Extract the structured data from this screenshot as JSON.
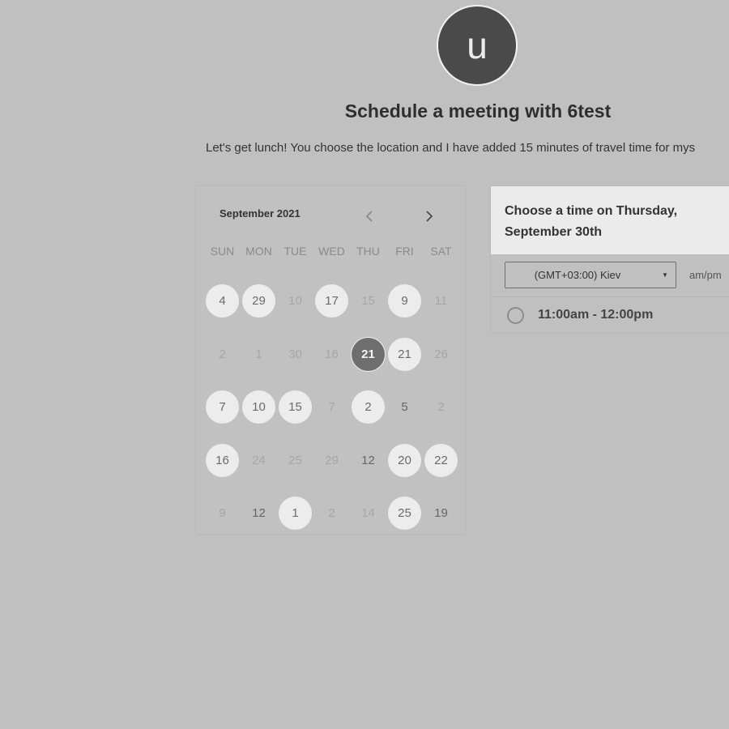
{
  "host": {
    "avatar_initial": "u",
    "title": "Schedule a meeting with 6test",
    "description": "Let's get lunch! You choose the location and I have added 15 minutes of travel time for mys"
  },
  "calendar": {
    "month_label": "September 2021",
    "prev_icon": "chevron-left-icon",
    "next_icon": "chevron-right-icon",
    "weekdays": [
      "SUN",
      "MON",
      "TUE",
      "WED",
      "THU",
      "FRI",
      "SAT"
    ],
    "weeks": [
      [
        {
          "label": "4",
          "state": "available"
        },
        {
          "label": "29",
          "state": "available"
        },
        {
          "label": "10",
          "state": "muted"
        },
        {
          "label": "17",
          "state": "available"
        },
        {
          "label": "15",
          "state": "muted"
        },
        {
          "label": "9",
          "state": "available"
        },
        {
          "label": "11",
          "state": "muted"
        }
      ],
      [
        {
          "label": "2",
          "state": "muted"
        },
        {
          "label": "1",
          "state": "muted"
        },
        {
          "label": "30",
          "state": "muted"
        },
        {
          "label": "16",
          "state": "muted"
        },
        {
          "label": "21",
          "state": "selected"
        },
        {
          "label": "21",
          "state": "available"
        },
        {
          "label": "26",
          "state": "muted"
        }
      ],
      [
        {
          "label": "7",
          "state": "available"
        },
        {
          "label": "10",
          "state": "available"
        },
        {
          "label": "15",
          "state": "available"
        },
        {
          "label": "7",
          "state": "muted"
        },
        {
          "label": "2",
          "state": "available"
        },
        {
          "label": "5",
          "state": "plain"
        },
        {
          "label": "2",
          "state": "muted"
        }
      ],
      [
        {
          "label": "16",
          "state": "available"
        },
        {
          "label": "24",
          "state": "muted"
        },
        {
          "label": "25",
          "state": "muted"
        },
        {
          "label": "29",
          "state": "muted"
        },
        {
          "label": "12",
          "state": "plain"
        },
        {
          "label": "20",
          "state": "available"
        },
        {
          "label": "22",
          "state": "available"
        }
      ],
      [
        {
          "label": "9",
          "state": "muted"
        },
        {
          "label": "12",
          "state": "plain"
        },
        {
          "label": "1",
          "state": "available"
        },
        {
          "label": "2",
          "state": "muted"
        },
        {
          "label": "14",
          "state": "muted"
        },
        {
          "label": "25",
          "state": "available"
        },
        {
          "label": "19",
          "state": "plain"
        }
      ]
    ]
  },
  "times": {
    "heading_line1": "Choose a time on Thursday,",
    "heading_line2": "September 30th",
    "timezone_value": "(GMT+03:00) Kiev",
    "timezone_caret_icon": "caret-down-icon",
    "format_label": "am/pm",
    "slots": [
      {
        "label": "11:00am - 12:00pm"
      }
    ]
  },
  "colors": {
    "background": "#c0c0c0",
    "selected_day": "#6e6e6e",
    "available_day": "#ececec",
    "header_panel": "#ebebeb"
  }
}
